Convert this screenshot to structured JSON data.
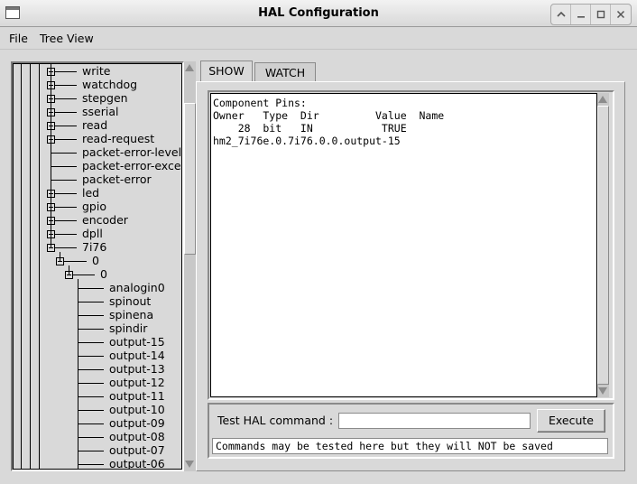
{
  "window": {
    "title": "HAL Configuration"
  },
  "menu": {
    "file": "File",
    "tree_view": "Tree View"
  },
  "tree": {
    "items": [
      {
        "label": "write",
        "expander": "plus"
      },
      {
        "label": "watchdog",
        "expander": "plus"
      },
      {
        "label": "stepgen",
        "expander": "plus"
      },
      {
        "label": "sserial",
        "expander": "plus"
      },
      {
        "label": "read",
        "expander": "plus"
      },
      {
        "label": "read-request",
        "expander": "plus"
      },
      {
        "label": "packet-error-level",
        "expander": "none"
      },
      {
        "label": "packet-error-exceeded",
        "expander": "none"
      },
      {
        "label": "packet-error",
        "expander": "none"
      },
      {
        "label": "led",
        "expander": "plus"
      },
      {
        "label": "gpio",
        "expander": "plus"
      },
      {
        "label": "encoder",
        "expander": "plus"
      },
      {
        "label": "dpll",
        "expander": "plus"
      },
      {
        "label": "7i76",
        "expander": "minus"
      },
      {
        "label": "0",
        "expander": "minus"
      },
      {
        "label": "0",
        "expander": "minus"
      },
      {
        "label": "analogin0",
        "expander": "none"
      },
      {
        "label": "spinout",
        "expander": "none"
      },
      {
        "label": "spinena",
        "expander": "none"
      },
      {
        "label": "spindir",
        "expander": "none"
      },
      {
        "label": "output-15",
        "expander": "none"
      },
      {
        "label": "output-14",
        "expander": "none"
      },
      {
        "label": "output-13",
        "expander": "none"
      },
      {
        "label": "output-12",
        "expander": "none"
      },
      {
        "label": "output-11",
        "expander": "none"
      },
      {
        "label": "output-10",
        "expander": "none"
      },
      {
        "label": "output-09",
        "expander": "none"
      },
      {
        "label": "output-08",
        "expander": "none"
      },
      {
        "label": "output-07",
        "expander": "none"
      },
      {
        "label": "output-06",
        "expander": "none"
      }
    ]
  },
  "tabs": {
    "show": "SHOW",
    "watch": "WATCH"
  },
  "show": {
    "lines": [
      "Component Pins:",
      "Owner   Type  Dir         Value  Name",
      "    28  bit   IN           TRUE",
      "hm2_7i76e.0.7i76.0.0.output-15"
    ]
  },
  "command": {
    "label": "Test HAL command :",
    "value": "",
    "execute_label": "Execute",
    "status": "Commands may be tested here but they will NOT be saved"
  }
}
